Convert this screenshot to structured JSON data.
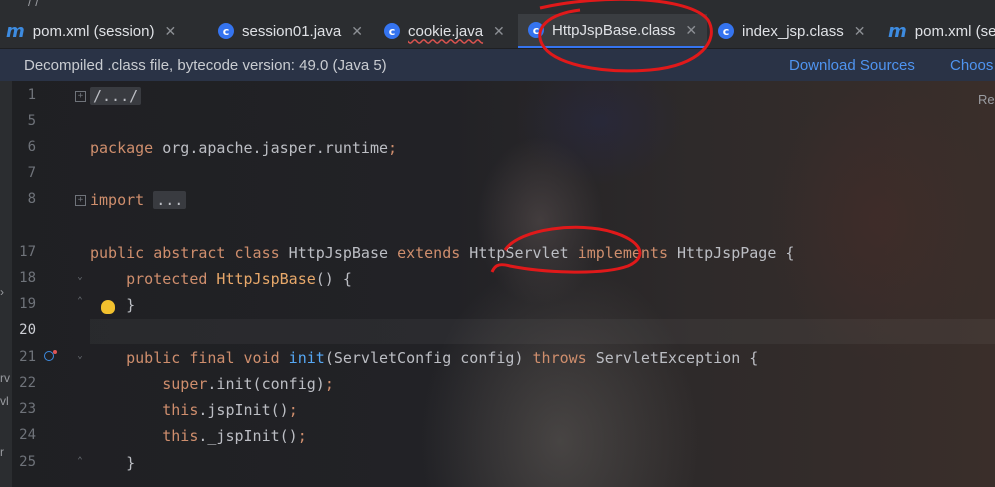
{
  "window": {
    "top_crumb": "/ /"
  },
  "tabs": [
    {
      "label": "pom.xml (session)",
      "icon": "maven-m-icon",
      "active": false
    },
    {
      "label": "session01.java",
      "icon": "java-class-icon",
      "active": false
    },
    {
      "label": "cookie.java",
      "icon": "java-class-icon",
      "active": false
    },
    {
      "label": "HttpJspBase.class",
      "icon": "compiled-class-icon",
      "active": true
    },
    {
      "label": "index_jsp.class",
      "icon": "java-class-icon",
      "active": false
    },
    {
      "label": "pom.xml (se",
      "icon": "maven-m-icon",
      "active": false
    }
  ],
  "banner": {
    "message": "Decompiled .class file, bytecode version: 49.0 (Java 5)",
    "download_sources": "Download Sources",
    "choose_sources": "Choos"
  },
  "right_hint": "Re",
  "left_panel": [
    "rv",
    "vl",
    "r"
  ],
  "editor": {
    "line_numbers": [
      "1",
      "5",
      "6",
      "7",
      "8",
      "17",
      "18",
      "19",
      "20",
      "21",
      "22",
      "23",
      "24",
      "25"
    ],
    "current_line": "20",
    "code": {
      "l1_fold": "/.../",
      "l6_kw": "package",
      "l6_rest": " org.apache.jasper.runtime",
      "l6_semi": ";",
      "l8_kw": "import",
      "l8_fold": "...",
      "l17_kw1": "public abstract class",
      "l17_name": " HttpJspBase ",
      "l17_kw2": "extends",
      "l17_super": " HttpServlet ",
      "l17_kw3": "implements",
      "l17_iface": " HttpJspPage {",
      "l18_kw": "protected",
      "l18_ctor": " HttpJspBase",
      "l18_rest": "() {",
      "l19": "}",
      "l21_kw": "public final void",
      "l21_fn": " init",
      "l21_params": "(ServletConfig config) ",
      "l21_kw2": "throws",
      "l21_exc": " ServletException {",
      "l22_kw": "super",
      "l22_rest": ".init(config)",
      "l22_semi": ";",
      "l23_kw": "this",
      "l23_rest": ".jspInit()",
      "l23_semi": ";",
      "l24_kw": "this",
      "l24_rest": "._jspInit()",
      "l24_semi": ";",
      "l25": "}"
    }
  },
  "colors": {
    "keyword": "#cf8e6d",
    "method": "#56a8f5",
    "link": "#4f94f0",
    "accent": "#3574f0",
    "annotation_red": "#e0191a"
  }
}
